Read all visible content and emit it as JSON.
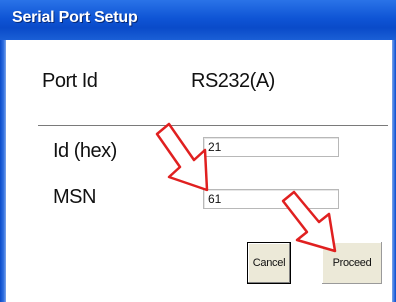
{
  "window": {
    "title": "Serial Port Setup"
  },
  "port": {
    "label": "Port Id",
    "value": "RS232(A)"
  },
  "id_field": {
    "label": "Id (hex)",
    "value": "21"
  },
  "msn_field": {
    "label": "MSN",
    "value": "61"
  },
  "buttons": {
    "cancel": "Cancel",
    "proceed": "Proceed"
  },
  "colors": {
    "titlebar": "#0a4bc9",
    "annotation_arrow": "#e02020"
  },
  "icons": [
    "arrow-annotation-icon"
  ]
}
